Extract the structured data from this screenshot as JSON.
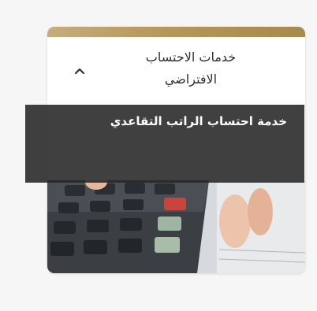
{
  "card": {
    "title_line1": "خدمات الاحتساب",
    "title_line2": "الافتراضي",
    "toggle_icon": "chevron-up-icon",
    "image_icon": "calculator-photo"
  },
  "dropdown": {
    "items": [
      {
        "label": "خدمة احتساب الراتب التقاعدي"
      }
    ]
  },
  "colors": {
    "accent_gold": "#b7975b",
    "dropdown_bg": "#262626",
    "title_text": "#2f2f2f"
  }
}
